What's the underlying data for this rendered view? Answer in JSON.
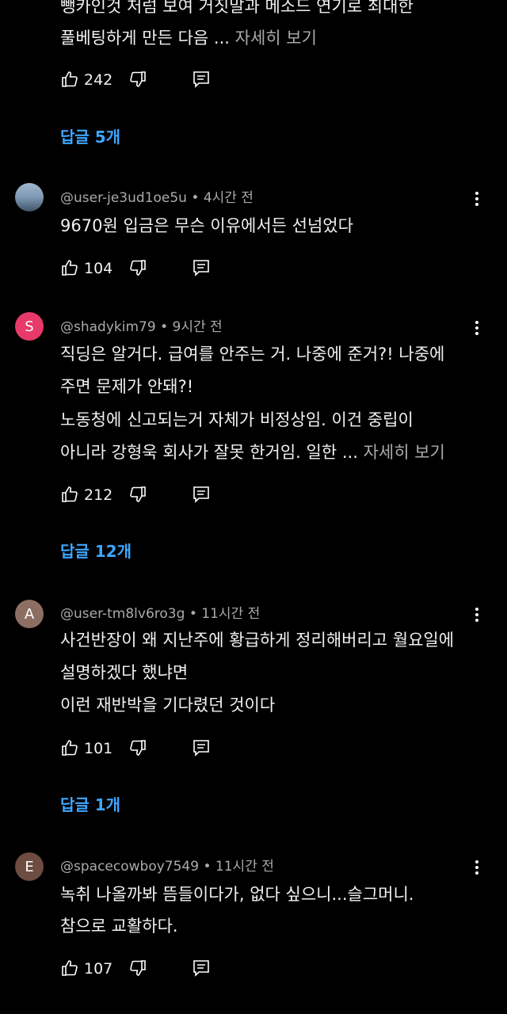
{
  "comments": [
    {
      "text_lines": [
        "뺑카인것 처럼 보여 거짓말과 메소드 연기로 최대한",
        "풀베팅하게 만든 다음 ..."
      ],
      "more": "자세히 보기",
      "likes": "242",
      "replies": "답글 5개"
    },
    {
      "handle": "@user-je3ud1oe5u",
      "time": "4시간 전",
      "text_lines": [
        "9670원 입금은 무슨 이유에서든 선넘었다"
      ],
      "likes": "104"
    },
    {
      "avatar_letter": "S",
      "avatar_color": "#e8396b",
      "handle": "@shadykim79",
      "time": "9시간 전",
      "text_lines": [
        "직딩은 알거다. 급여를 안주는 거. 나중에 준거?! 나중에",
        "주면 문제가 안돼?!",
        "노동청에 신고되는거 자체가 비정상임. 이건 중립이",
        "아니라 강형욱 회사가 잘못 한거임. 일한 ..."
      ],
      "more": "자세히 보기",
      "likes": "212",
      "replies": "답글 12개"
    },
    {
      "avatar_letter": "A",
      "avatar_color": "#8d6e63",
      "handle": "@user-tm8lv6ro3g",
      "time": "11시간 전",
      "text_lines": [
        "사건반장이 왜 지난주에 황급하게 정리해버리고 월요일에",
        "설명하겠다 했냐면",
        "이런 재반박을 기다렸던 것이다"
      ],
      "likes": "101",
      "replies": "답글 1개"
    },
    {
      "avatar_letter": "E",
      "avatar_color": "#6d4c41",
      "handle": "@spacecowboy7549",
      "time": "11시간 전",
      "text_lines": [
        "녹취 나올까봐 뜸들이다가, 없다 싶으니...슬그머니.",
        "참으로 교활하다."
      ],
      "likes": "107"
    }
  ],
  "separator": "•",
  "icons": [
    "thumb-up-icon",
    "thumb-down-icon",
    "reply-icon",
    "more-vert-icon"
  ]
}
